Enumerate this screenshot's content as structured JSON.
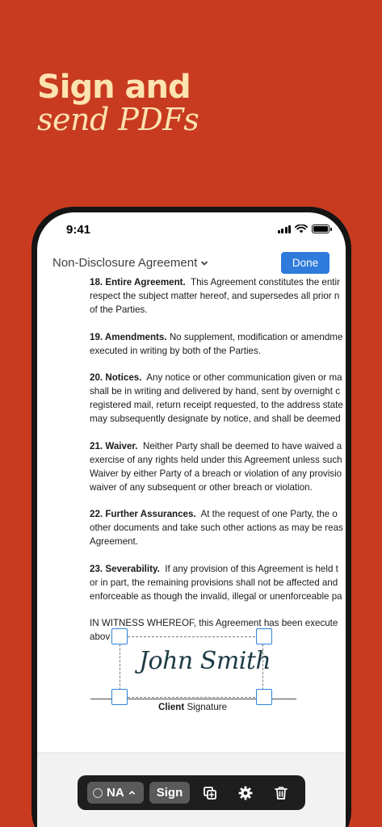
{
  "headline": {
    "line1": "Sign and",
    "line2": "send PDFs"
  },
  "status_bar": {
    "time": "9:41"
  },
  "navbar": {
    "document_title": "Non-Disclosure Agreement",
    "done_label": "Done"
  },
  "document": {
    "sections": [
      {
        "heading": "18. Entire Agreement.",
        "line1_rest": "This Agreement constitutes the entir",
        "lines": [
          "respect the subject matter hereof, and supersedes all prior n",
          "of the Parties."
        ]
      },
      {
        "heading": "19. Amendments.",
        "line1_rest": "No supplement, modification or amendme",
        "lines": [
          "executed in writing by both of the Parties."
        ]
      },
      {
        "heading": "20. Notices.",
        "line1_rest": "Any notice or other communication given or ma",
        "lines": [
          "shall be in writing and delivered by hand, sent by overnight c",
          "registered mail, return receipt requested, to the address state",
          "may subsequently designate by notice, and shall be deemed"
        ]
      },
      {
        "heading": "21. Waiver.",
        "line1_rest": "Neither Party shall be deemed to have waived a",
        "lines": [
          "exercise of any rights held under this Agreement unless such",
          "Waiver by either Party of a breach or violation of any provisio",
          "waiver of any subsequent or other breach or violation."
        ]
      },
      {
        "heading": "22. Further Assurances.",
        "line1_rest": "At the request of one Party, the o",
        "lines": [
          "other documents and take such other actions as may be reas",
          "Agreement."
        ]
      },
      {
        "heading": "23. Severability.",
        "line1_rest": "If any provision of this Agreement is held t",
        "lines": [
          "or in part, the remaining provisions shall not be affected and",
          "enforceable as though the invalid, illegal or unenforceable pa"
        ]
      }
    ],
    "witness_line1": "IN WITNESS WHEREOF, this Agreement has been execute",
    "witness_line2": "abov",
    "signature_name": "John Smith",
    "signature_caption_bold": "Client",
    "signature_caption_rest": " Signature"
  },
  "toolbar": {
    "initials_label": "NA",
    "sign_label": "Sign",
    "icons": [
      "duplicate-icon",
      "gear-icon",
      "trash-icon"
    ]
  },
  "colors": {
    "background": "#C83B21",
    "headline": "#FCE3B0",
    "accent_blue": "#2E7BDB",
    "toolbar": "#1E1E1E"
  }
}
